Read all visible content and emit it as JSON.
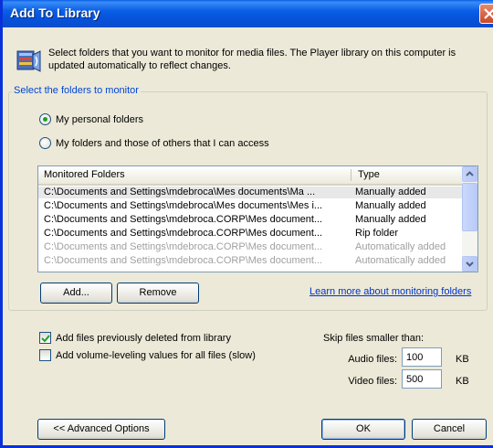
{
  "window": {
    "title": "Add To Library"
  },
  "intro_text": "Select folders that you want to monitor for media files. The Player library on this computer is updated automatically to reflect changes.",
  "group_label": "Select the folders to monitor",
  "radio_personal": "My personal folders",
  "radio_all": "My folders and those of others that I can access",
  "list": {
    "col_folder": "Monitored Folders",
    "col_type": "Type",
    "rows": [
      {
        "path": "C:\\Documents and Settings\\mdebroca\\Mes documents\\Ma ...",
        "type": "Manually added"
      },
      {
        "path": "C:\\Documents and Settings\\mdebroca\\Mes documents\\Mes i...",
        "type": "Manually added"
      },
      {
        "path": "C:\\Documents and Settings\\mdebroca.CORP\\Mes document...",
        "type": "Manually added"
      },
      {
        "path": "C:\\Documents and Settings\\mdebroca.CORP\\Mes document...",
        "type": "Rip folder"
      },
      {
        "path": "C:\\Documents and Settings\\mdebroca.CORP\\Mes document...",
        "type": "Automatically added"
      },
      {
        "path": "C:\\Documents and Settings\\mdebroca.CORP\\Mes document...",
        "type": "Automatically added"
      }
    ]
  },
  "buttons": {
    "add": "Add...",
    "remove": "Remove",
    "advanced": "<< Advanced Options",
    "ok": "OK",
    "cancel": "Cancel"
  },
  "learn_link": "Learn more about monitoring folders",
  "check_deleted": "Add files previously deleted from library",
  "check_volume": "Add volume-leveling values for all files (slow)",
  "skip": {
    "label": "Skip files smaller than:",
    "audio_label": "Audio files:",
    "audio_value": "100",
    "video_label": "Video files:",
    "video_value": "500",
    "unit": "KB"
  },
  "state": {
    "personal_selected": true,
    "deleted_checked": true,
    "volume_checked": false
  }
}
